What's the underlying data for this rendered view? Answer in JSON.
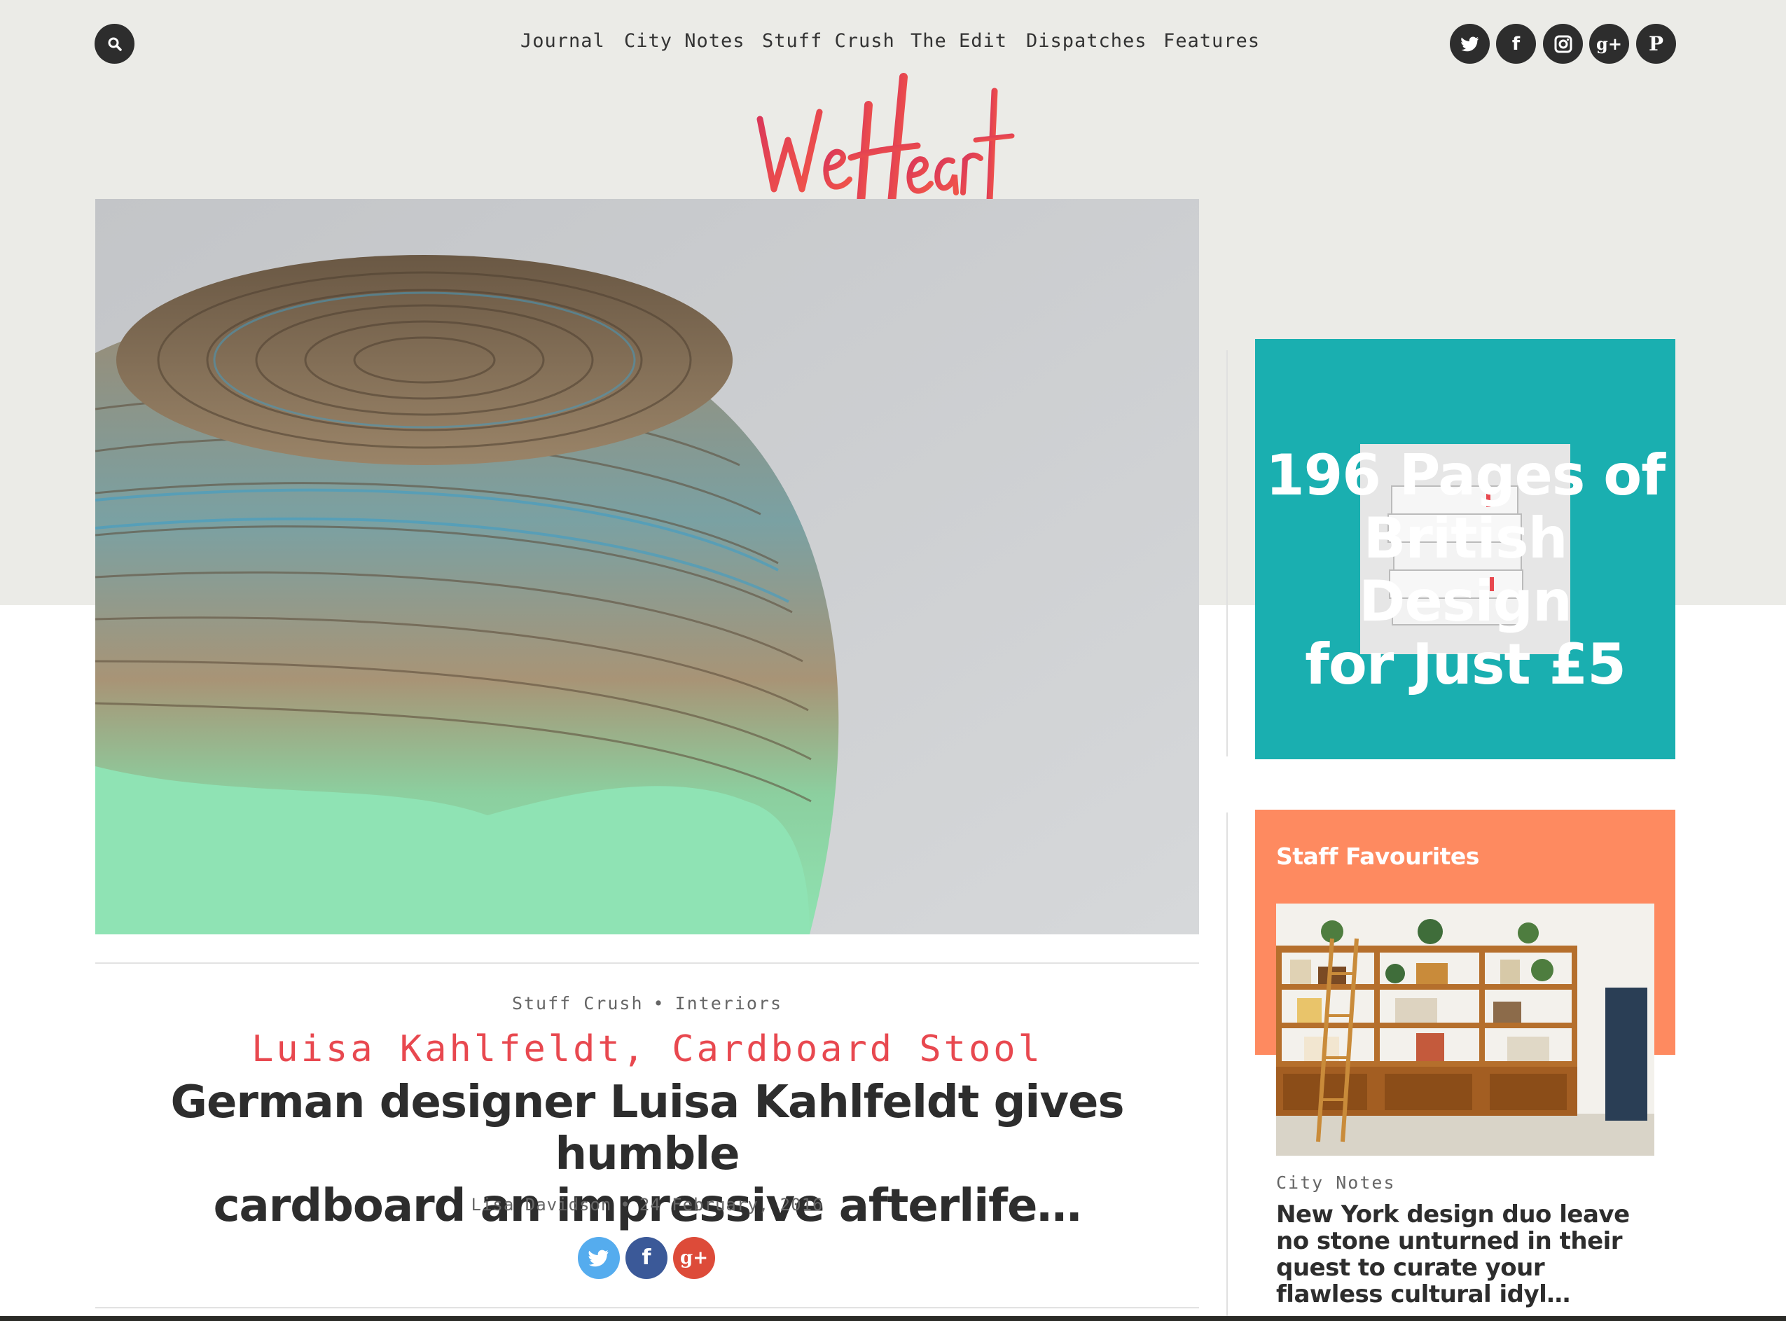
{
  "nav": {
    "items": [
      "Journal",
      "City Notes",
      "Stuff Crush",
      "The Edit",
      "Dispatches",
      "Features"
    ]
  },
  "social": [
    "twitter-icon",
    "facebook-icon",
    "instagram-icon",
    "google-plus-icon",
    "pinterest-icon"
  ],
  "logo": {
    "text": "We Heart"
  },
  "article": {
    "categories": [
      "Stuff Crush",
      "Interiors"
    ],
    "separator": "•",
    "kicker": "Luisa Kahlfeldt, Cardboard Stool",
    "headline_line1": "German designer Luisa Kahlfeldt gives humble",
    "headline_line2": "cardboard an impressive afterlife…",
    "author": "Lisa Davidson",
    "date": "24 February, 2016"
  },
  "sidebar": {
    "ad": {
      "line1": "196 Pages of",
      "line2": "British Design",
      "line3": "for Just £5"
    },
    "staff": {
      "title": "Staff Favourites",
      "category": "City Notes",
      "headline": "New York design duo leave no stone unturned in their quest to curate your flawless cultural idyl…"
    }
  },
  "colors": {
    "top_band": "#ebebe7",
    "accent_red": "#e8484f",
    "ad_teal": "#1aafb0",
    "staff_orange": "#fe8a60",
    "twitter": "#55acee",
    "facebook": "#3b5998",
    "google_plus": "#dd4b39"
  }
}
